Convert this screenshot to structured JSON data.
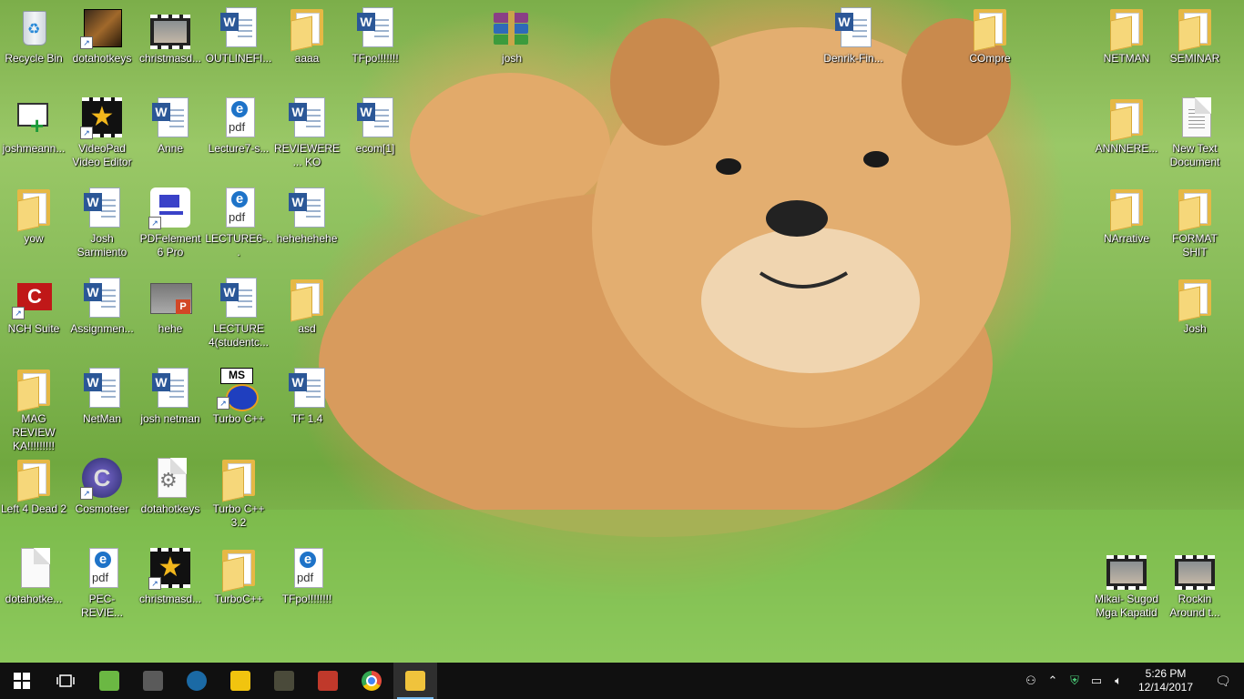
{
  "desktop": {
    "icons": [
      {
        "label": "Recycle Bin",
        "type": "bin"
      },
      {
        "label": "dotahotkeys",
        "type": "game"
      },
      {
        "label": "christmasd...",
        "type": "video"
      },
      {
        "label": "OUTLINEFI...",
        "type": "word"
      },
      {
        "label": "aaaa",
        "type": "folder"
      },
      {
        "label": "TFpo!!!!!!!",
        "type": "word"
      },
      {
        "label": "josh",
        "type": "rar"
      },
      {
        "label": "Denrik-Fin...",
        "type": "word"
      },
      {
        "label": "COmpre",
        "type": "folder"
      },
      {
        "label": "NETMAN",
        "type": "folder"
      },
      {
        "label": "SEMINAR",
        "type": "folder"
      },
      {
        "label": "joshmeann...",
        "type": "mail"
      },
      {
        "label": "VideoPad Video Editor",
        "type": "star"
      },
      {
        "label": "Anne",
        "type": "word"
      },
      {
        "label": "Lecture7-s...",
        "type": "pdf"
      },
      {
        "label": "REVIEWERE... KO",
        "type": "word"
      },
      {
        "label": "ecom[1]",
        "type": "word"
      },
      {
        "label": "ANNNERE...",
        "type": "folder"
      },
      {
        "label": "New Text Document",
        "type": "text"
      },
      {
        "label": "yow",
        "type": "folder"
      },
      {
        "label": "Josh Sarmiento",
        "type": "word"
      },
      {
        "label": "PDFelement 6 Pro",
        "type": "pdfelement"
      },
      {
        "label": "LECTURE6-...",
        "type": "pdf"
      },
      {
        "label": "hehehehehe",
        "type": "word"
      },
      {
        "label": "NArrative",
        "type": "folder"
      },
      {
        "label": "FORMAT SHIT",
        "type": "folder"
      },
      {
        "label": "NCH Suite",
        "type": "nch"
      },
      {
        "label": "Assignmen...",
        "type": "word"
      },
      {
        "label": "hehe",
        "type": "ppt"
      },
      {
        "label": "LECTURE 4(studentc...",
        "type": "word"
      },
      {
        "label": "asd",
        "type": "folder"
      },
      {
        "label": "Josh",
        "type": "folder"
      },
      {
        "label": "MAG REVIEW KA!!!!!!!!!",
        "type": "folder"
      },
      {
        "label": "NetMan",
        "type": "word"
      },
      {
        "label": "josh netman",
        "type": "word"
      },
      {
        "label": "Turbo C++",
        "type": "turbo"
      },
      {
        "label": "TF 1.4",
        "type": "word"
      },
      {
        "label": "Left 4 Dead 2",
        "type": "folder"
      },
      {
        "label": "Cosmoteer",
        "type": "cosmo"
      },
      {
        "label": "dotahotkeys",
        "type": "gear"
      },
      {
        "label": "Turbo C++ 3.2",
        "type": "folder"
      },
      {
        "label": "dotahotke...",
        "type": "plain"
      },
      {
        "label": "PEC-REVIE...",
        "type": "pdf"
      },
      {
        "label": "christmasd...",
        "type": "star"
      },
      {
        "label": "TurboC++",
        "type": "folder"
      },
      {
        "label": "TFpo!!!!!!!!",
        "type": "pdf"
      },
      {
        "label": "Mikai- Sugod Mga Kapatid",
        "type": "video"
      },
      {
        "label": "Rockin Around t...",
        "type": "video"
      }
    ]
  },
  "taskbar": {
    "start_icon": "windows-logo-icon",
    "task_view_icon": "task-view-icon",
    "pinned": [
      {
        "name": "bluestacks",
        "color": "#6bb843"
      },
      {
        "name": "dota2",
        "color": "#5a5a5a"
      },
      {
        "name": "steam",
        "color": "#1b6aa5"
      },
      {
        "name": "garena",
        "color": "#f1c40f"
      },
      {
        "name": "modern-warfare",
        "color": "#4a4a3a"
      },
      {
        "name": "game-4",
        "color": "#c0392b"
      },
      {
        "name": "chrome",
        "color": "#e74c3c"
      },
      {
        "name": "file-explorer",
        "color": "#f0c33c"
      }
    ],
    "tray": {
      "time": "5:26 PM",
      "date": "12/14/2017"
    }
  }
}
